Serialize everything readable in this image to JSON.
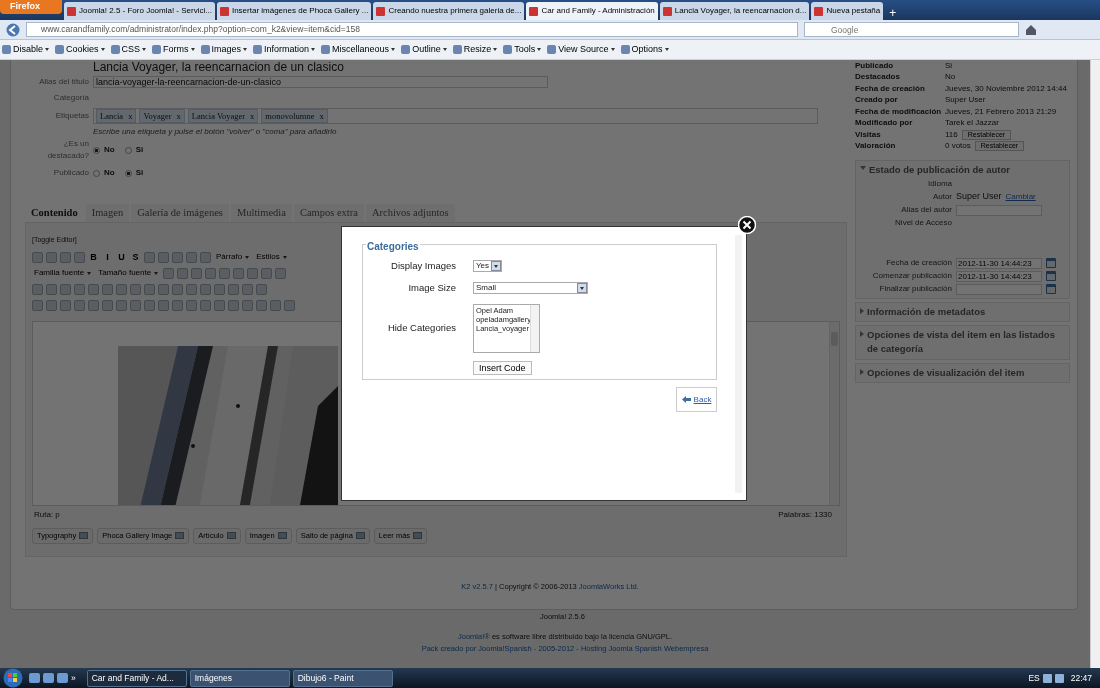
{
  "browser": {
    "menu_button": "Firefox",
    "new_tab": "+",
    "tabs": [
      {
        "title": "Joomla! 2.5 - Foro Joomla! - Servici...",
        "selected": false
      },
      {
        "title": "Insertar imágenes de Phoca Gallery ...",
        "selected": false
      },
      {
        "title": "Creando nuestra primera galeria de...",
        "selected": false
      },
      {
        "title": "Car and Family - Administración",
        "selected": true
      },
      {
        "title": "Lancia Voyager, la reencarnacion d...",
        "selected": false
      },
      {
        "title": "Nueva pestaña",
        "selected": false
      }
    ],
    "url": "www.carandfamily.com/administrator/index.php?option=com_k2&view=item&cid=158",
    "search_placeholder": "Google",
    "devbar": [
      "Disable",
      "Cookies",
      "CSS",
      "Forms",
      "Images",
      "Information",
      "Miscellaneous",
      "Outline",
      "Resize",
      "Tools",
      "View Source",
      "Options"
    ]
  },
  "item": {
    "title": "Lancia Voyager, la reencarnacion de un clasico",
    "alias": {
      "label": "Alias del título",
      "value": "lancia-voyager-la-reencarnacion-de-un-clasico"
    },
    "category": {
      "label": "Categoría"
    },
    "tags": {
      "label": "Etiquetas",
      "items": [
        {
          "label": "Lancia",
          "remove": "x"
        },
        {
          "label": "Voyager",
          "remove": "x"
        },
        {
          "label": "Lancia Voyager",
          "remove": "x"
        },
        {
          "label": "monovolumne",
          "remove": "x"
        }
      ],
      "hint": "Escribe una etiqueta y pulse el botón \"volver\" o \"coma\" para añadirlo"
    },
    "featured": {
      "label": "¿Es un destacado?",
      "options": [
        {
          "label": "No",
          "selected": true
        },
        {
          "label": "Si",
          "selected": false
        }
      ]
    },
    "published": {
      "label": "Publicado",
      "options": [
        {
          "label": "No",
          "selected": false
        },
        {
          "label": "Si",
          "selected": true
        }
      ]
    }
  },
  "tabs": [
    {
      "label": "Contenido",
      "selected": true
    },
    {
      "label": "Imagen",
      "selected": false
    },
    {
      "label": "Galería de imágenes",
      "selected": false
    },
    {
      "label": "Multimedia",
      "selected": false
    },
    {
      "label": "Campos extra",
      "selected": false
    },
    {
      "label": "Archivos adjuntos",
      "selected": false
    }
  ],
  "editor": {
    "toggle": "[Toggle Editor]",
    "toolbar_rows": [
      [
        {
          "kind": "icon"
        },
        {
          "kind": "icon"
        },
        {
          "kind": "icon"
        },
        {
          "kind": "icon"
        },
        {
          "kind": "letter",
          "text": "B"
        },
        {
          "kind": "letter",
          "text": "I"
        },
        {
          "kind": "letter",
          "text": "U"
        },
        {
          "kind": "letter",
          "text": "S"
        },
        {
          "kind": "icon"
        },
        {
          "kind": "icon"
        },
        {
          "kind": "icon"
        },
        {
          "kind": "icon"
        },
        {
          "kind": "icon"
        },
        {
          "kind": "select",
          "text": "Párrafo"
        },
        {
          "kind": "select",
          "text": "Estilos"
        }
      ],
      [
        {
          "kind": "select",
          "text": "Familia fuente"
        },
        {
          "kind": "select",
          "text": "Tamaño fuente"
        },
        {
          "kind": "icon"
        },
        {
          "kind": "icon"
        },
        {
          "kind": "icon"
        },
        {
          "kind": "icon"
        },
        {
          "kind": "icon"
        },
        {
          "kind": "icon"
        },
        {
          "kind": "icon"
        },
        {
          "kind": "icon"
        },
        {
          "kind": "icon"
        }
      ],
      [
        {
          "kind": "icon"
        },
        {
          "kind": "icon"
        },
        {
          "kind": "icon"
        },
        {
          "kind": "icon"
        },
        {
          "kind": "icon"
        },
        {
          "kind": "icon"
        },
        {
          "kind": "icon"
        },
        {
          "kind": "icon"
        },
        {
          "kind": "icon"
        },
        {
          "kind": "icon"
        },
        {
          "kind": "icon"
        },
        {
          "kind": "icon"
        },
        {
          "kind": "icon"
        },
        {
          "kind": "icon"
        },
        {
          "kind": "icon"
        },
        {
          "kind": "icon"
        },
        {
          "kind": "icon"
        }
      ],
      [
        {
          "kind": "icon"
        },
        {
          "kind": "icon"
        },
        {
          "kind": "icon"
        },
        {
          "kind": "icon"
        },
        {
          "kind": "icon"
        },
        {
          "kind": "icon"
        },
        {
          "kind": "icon"
        },
        {
          "kind": "icon"
        },
        {
          "kind": "icon"
        },
        {
          "kind": "icon"
        },
        {
          "kind": "icon"
        },
        {
          "kind": "icon"
        },
        {
          "kind": "icon"
        },
        {
          "kind": "icon"
        },
        {
          "kind": "icon"
        },
        {
          "kind": "icon"
        },
        {
          "kind": "icon"
        },
        {
          "kind": "icon"
        },
        {
          "kind": "icon"
        }
      ]
    ],
    "path": "Ruta: p",
    "words": "Palabras: 1330",
    "buttons": [
      "Typography",
      "Phoca Gallery Image",
      "Artículo",
      "Imagen",
      "Salto de página",
      "Leer más"
    ]
  },
  "info": [
    {
      "label": "Publicado",
      "value": "Si"
    },
    {
      "label": "Destacados",
      "value": "No"
    },
    {
      "label": "Fecha de creación",
      "value": "Jueves, 30 Noviembre 2012 14:44"
    },
    {
      "label": "Creado por",
      "value": "Super User"
    },
    {
      "label": "Fecha de modificación",
      "value": "Jueves, 21 Febrero 2013 21:29"
    },
    {
      "label": "Modificado por",
      "value": "Tarek el Jazzar"
    },
    {
      "label": "Visitas",
      "value": "116",
      "button": "Restablecer"
    },
    {
      "label": "Valoración",
      "value": "0 votos",
      "button": "Restablecer"
    }
  ],
  "sections": [
    {
      "title": "Estado de publicación de autor",
      "expanded": true,
      "fields": [
        {
          "kind": "blank",
          "label": "Idioma"
        },
        {
          "kind": "link",
          "label": "Autor",
          "value": "Super User",
          "link": "Cambiar"
        },
        {
          "kind": "input",
          "label": "Alias del autor"
        },
        {
          "kind": "tall",
          "label": "Nivel de Acceso"
        },
        {
          "kind": "date",
          "label": "Fecha de creación",
          "value": "2012-11-30 14:44:23"
        },
        {
          "kind": "date",
          "label": "Comenzar publicación",
          "value": "2012-11-30 14:44:23"
        },
        {
          "kind": "date",
          "label": "Finalizar publicación"
        }
      ]
    },
    {
      "title": "Información de metadatos",
      "expanded": false
    },
    {
      "title": "Opciones de vista del item en las listados de categoría",
      "expanded": false
    },
    {
      "title": "Opciones de visualización del item",
      "expanded": false
    }
  ],
  "footer": {
    "k2": "K2 v2.5.7",
    "copyright": "| Copyright © 2006-2013",
    "company": "JoomlaWorks Ltd.",
    "version": "Joomla! 2.5.6",
    "license_link": "Joomla!®",
    "license": "es software libre distribuido bajo la licencia GNU/GPL.",
    "pack": "Pack creado por Joomla!Spanish - 2005-2012 - Hosting Joomla Spanish Webempresa"
  },
  "dialog": {
    "legend": "Categories",
    "fields": [
      {
        "kind": "select",
        "label": "Display Images",
        "value": "Yes"
      },
      {
        "kind": "wide_select",
        "label": "Image Size",
        "value": "Small"
      },
      {
        "kind": "list",
        "label": "Hide Categories",
        "options": [
          "Opel Adam",
          "opeladamgallery",
          "Lancia_voyager"
        ]
      }
    ],
    "insert_button": "Insert Code",
    "back_link": "Back"
  },
  "taskbar": {
    "more": "»",
    "tasks": [
      {
        "label": "Car and Family - Ad...",
        "selected": true
      },
      {
        "label": "Imágenes",
        "selected": false
      },
      {
        "label": "Dibujo6 - Paint",
        "selected": false
      }
    ],
    "language": "ES",
    "time": "22:47"
  }
}
